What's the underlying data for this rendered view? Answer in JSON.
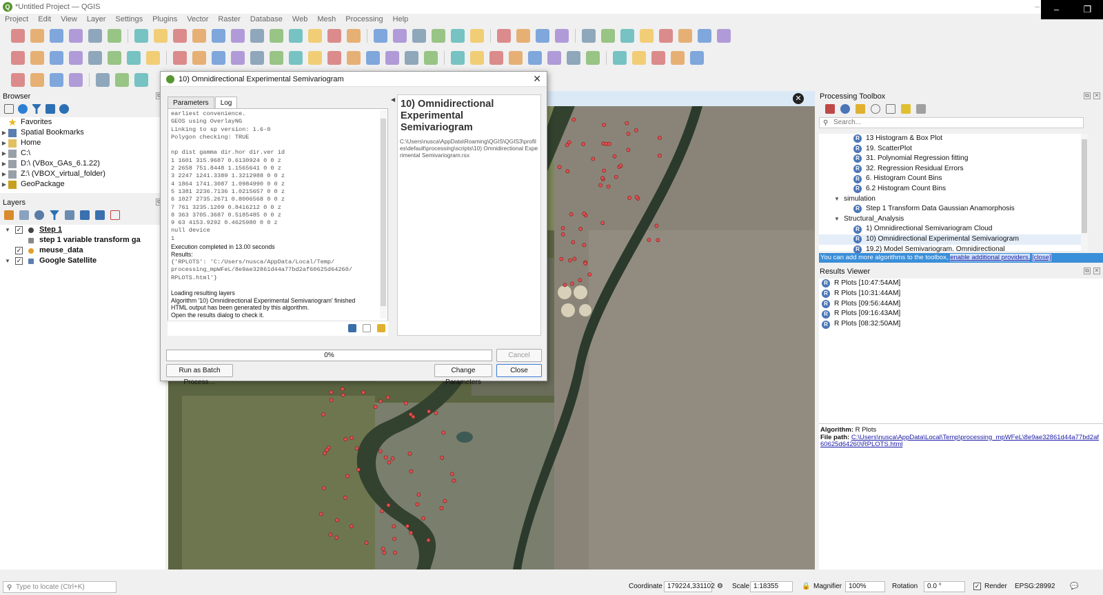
{
  "window": {
    "title": "*Untitled Project — QGIS",
    "logo_letter": "Q"
  },
  "menu": [
    "Project",
    "Edit",
    "View",
    "Layer",
    "Settings",
    "Plugins",
    "Vector",
    "Raster",
    "Database",
    "Web",
    "Mesh",
    "Processing",
    "Help"
  ],
  "browser": {
    "title": "Browser",
    "items": [
      {
        "label": "Favorites",
        "icon": "star-icon"
      },
      {
        "label": "Spatial Bookmarks",
        "icon": "bookmark-icon"
      },
      {
        "label": "Home",
        "icon": "folder-icon"
      },
      {
        "label": "C:\\",
        "icon": "drive-icon"
      },
      {
        "label": "D:\\ (VBox_GAs_6.1.22)",
        "icon": "drive-icon"
      },
      {
        "label": "Z:\\ (VBOX_virtual_folder)",
        "icon": "drive-icon"
      },
      {
        "label": "GeoPackage",
        "icon": "geopackage-icon"
      }
    ]
  },
  "layers": {
    "title": "Layers",
    "items": [
      {
        "label": "Step 1",
        "checked": true,
        "bold": true,
        "underline": true
      },
      {
        "label": "step 1 variable transform ga",
        "checked": false,
        "bold": true
      },
      {
        "label": "meuse_data",
        "checked": true,
        "bold": true
      },
      {
        "label": "Google Satellite",
        "checked": true,
        "bold": true
      }
    ]
  },
  "dialog": {
    "title": "10) Omnidirectional Experimental Semivariogram",
    "tabs": [
      "Parameters",
      "Log"
    ],
    "log_mono": "earliest convenience.\nGEOS using OverlayNG\nLinking to sp version: 1.6-0\nPolygon checking: TRUE\n\nnp dist gamma dir.hor dir.ver id\n1 1601 315.9687 0.6130924 0 0 z\n2 2658 751.8448 1.1565641 0 0 z\n3 2247 1241.3389 1.3212988 0 0 z\n4 1864 1741.3087 1.0984990 0 0 z\n5 1381 2236.7136 1.0215657 0 0 z\n6 1027 2735.2671 0.8006568 0 0 z\n7 761 3235.1209 0.8416212 0 0 z\n8 363 3705.3687 0.5185485 0 0 z\n9 63 4153.9292 0.4625980 0 0 z\nnull device\n1",
    "log_exec": "Execution completed in 13.00 seconds",
    "log_results_label": "Results:",
    "log_results_mono": "{'RPLOTS': 'C:/Users/nusca/AppData/Local/Temp/\nprocessing_mpWFeL/8e9ae32861d44a77bd2af60625d64260/\nRPLOTS.html'}",
    "log_tail": [
      "Loading resulting layers",
      "Algorithm '10) Omnidirectional Experimental Semivariogram' finished",
      "HTML output has been generated by this algorithm.",
      "Open the results dialog to check it."
    ],
    "help_title": "10) Omnidirectional Experimental Semivariogram",
    "help_path": "C:\\Users\\nusca\\AppData\\Roaming\\QGIS\\QGIS3\\profiles\\default\\processing\\scripts\\10) Omnidirectional Experimental Semivariogram.rsx",
    "progress": "0%",
    "progress_value": 0,
    "cancel": "Cancel",
    "batch": "Run as Batch Process…",
    "change_params": "Change Parameters",
    "close": "Close"
  },
  "toolbox": {
    "title": "Processing Toolbox",
    "search_placeholder": "Search...",
    "algs": [
      {
        "label": "13 Histogram & Box Plot",
        "level": 2
      },
      {
        "label": "19. ScatterPlot",
        "level": 2
      },
      {
        "label": "31. Polynomial Regression fitting",
        "level": 2
      },
      {
        "label": "32. Regression Residual Errors",
        "level": 2
      },
      {
        "label": "6. Histogram Count Bins",
        "level": 2
      },
      {
        "label": "6.2 Histogram Count Bins",
        "level": 2
      },
      {
        "label": "simulation",
        "level": 1,
        "group": true
      },
      {
        "label": "Step 1 Transform Data Gaussian Anamorphosis",
        "level": 2
      },
      {
        "label": "Structural_Analysis",
        "level": 1,
        "group": true
      },
      {
        "label": "1) Omnidirectional Semivariogram Cloud",
        "level": 2
      },
      {
        "label": "10) Omnidirectional Experimental Semivariogram",
        "level": 2
      },
      {
        "label": "19.2) Model Semivariogram. Omnidirectional",
        "level": 2
      }
    ],
    "providers_msg": "You can add more algorithms to the toolbox,",
    "providers_link": "enable additional providers.",
    "providers_close": "[close]"
  },
  "results": {
    "title": "Results Viewer",
    "items": [
      "R Plots [10:47:54AM]",
      "R Plots [10:31:44AM]",
      "R Plots [09:56:44AM]",
      "R Plots [09:16:43AM]",
      "R Plots [08:32:50AM]"
    ],
    "algorithm_label": "Algorithm:",
    "algorithm_value": "R Plots",
    "filepath_label": "File path:",
    "filepath_value": "C:\\Users\\nusca\\AppData\\Local\\Temp\\processing_mpWFeL\\8e9ae32861d44a77bd2af60625d64260\\RPLOTS.html"
  },
  "status": {
    "locate_placeholder": "Type to locate (Ctrl+K)",
    "coordinate_label": "Coordinate",
    "coordinate_value": "179224,331102",
    "scale_label": "Scale",
    "scale_value": "1:18355",
    "magnifier_label": "Magnifier",
    "magnifier_value": "100%",
    "rotation_label": "Rotation",
    "rotation_value": "0.0 °",
    "render_label": "Render",
    "crs": "EPSG:28992"
  },
  "colors": {
    "accent": "#3a8fd9",
    "qgis_green": "#589632",
    "r_blue": "#4a76b8",
    "point_red": "#e05050"
  }
}
